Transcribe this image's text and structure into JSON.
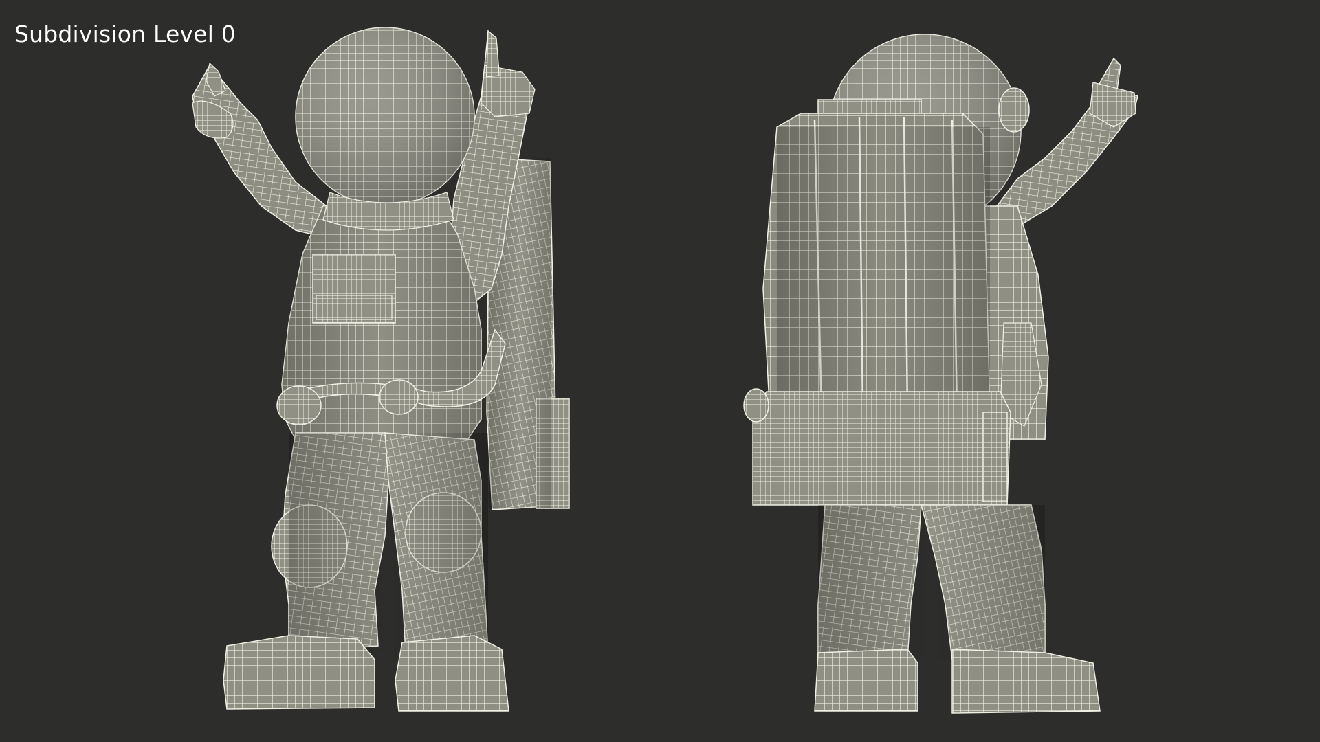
{
  "viewport": {
    "label": "Subdivision Level 0",
    "background": "#2d2d2b",
    "mesh_fill": "#8f8f84",
    "wire_color": "#f0efe4"
  },
  "figures": [
    {
      "name": "astronaut-front-view"
    },
    {
      "name": "astronaut-back-view"
    }
  ]
}
